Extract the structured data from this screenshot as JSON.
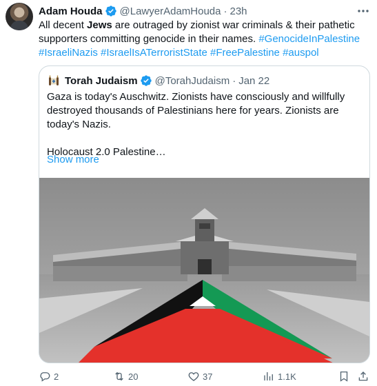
{
  "tweet": {
    "author_name": "Adam Houda",
    "handle": "@LawyerAdamHouda",
    "separator": "·",
    "time": "23h",
    "text": {
      "part1": "All decent ",
      "bold": "Jews",
      "part2": " are outraged by zionist war criminals & their pathetic supporters committing genocide in their names. ",
      "hashtags": [
        "#GenocideInPalestine",
        "#IsraeliNazis",
        "#IsraelIsATerroristState",
        "#FreePalestine",
        "#auspol"
      ]
    }
  },
  "quote": {
    "author_name": "Torah Judaism",
    "handle": "@TorahJudaism",
    "separator": "·",
    "date": "Jan 22",
    "paragraph1": "Gaza is today's Auschwitz. Zionists have consciously and willfully destroyed thousands of Palestinians here for years. Zionists are today's Nazis.",
    "paragraph2": "Holocaust 2.0 Palestine…",
    "show_more": "Show more"
  },
  "actions": {
    "replies": "2",
    "reposts": "20",
    "likes": "37",
    "views": "1.1K"
  },
  "colors": {
    "link": "#1d9bf0",
    "secondary_text": "#536471",
    "border": "#cfd9de",
    "flag_red": "#e4312b",
    "flag_green": "#149954",
    "flag_black": "#000000"
  }
}
